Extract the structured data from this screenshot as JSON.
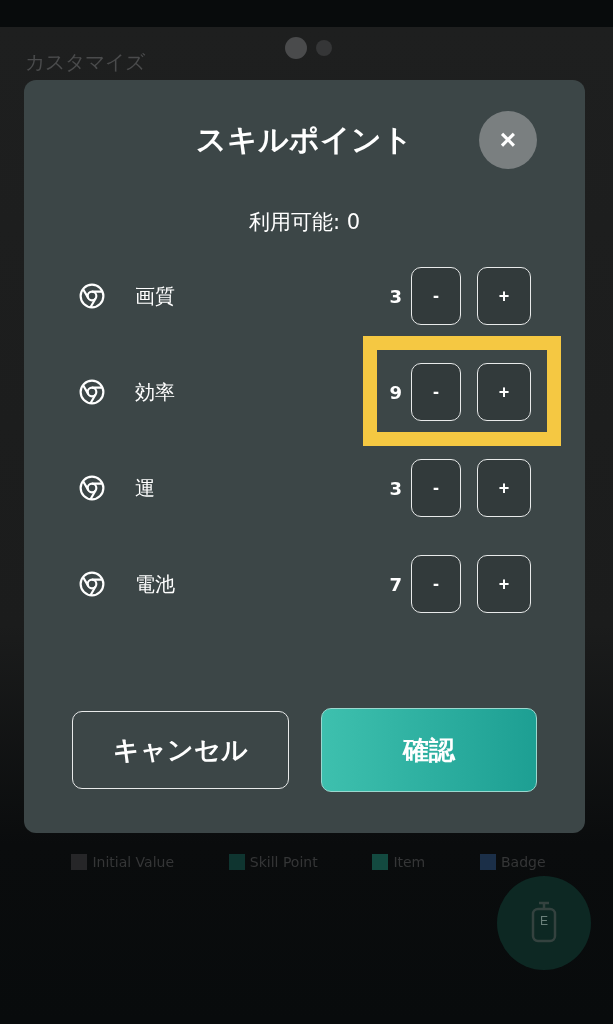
{
  "background": {
    "title": "カスタマイズ",
    "pager": [
      {
        "selected": true
      },
      {
        "selected": false
      }
    ],
    "legend": [
      {
        "label": "Initial Value",
        "color": "#262628"
      },
      {
        "label": "Skill Point",
        "color": "#0f3530"
      },
      {
        "label": "Item",
        "color": "#134a40"
      },
      {
        "label": "Badge",
        "color": "#1b2f48"
      }
    ],
    "fab": {
      "label": "E"
    }
  },
  "dialog": {
    "title": "スキルポイント",
    "close": "×",
    "available": "利用可能: 0",
    "skills": [
      {
        "name": "画質",
        "value": "3",
        "minus": "-",
        "plus": "+",
        "highlighted": false
      },
      {
        "name": "効率",
        "value": "9",
        "minus": "-",
        "plus": "+",
        "highlighted": true
      },
      {
        "name": "運",
        "value": "3",
        "minus": "-",
        "plus": "+",
        "highlighted": false
      },
      {
        "name": "電池",
        "value": "7",
        "minus": "-",
        "plus": "+",
        "highlighted": false
      }
    ],
    "buttons": [
      {
        "label": "キャンセル",
        "kind": "secondary"
      },
      {
        "label": "確認",
        "kind": "primary"
      }
    ]
  }
}
